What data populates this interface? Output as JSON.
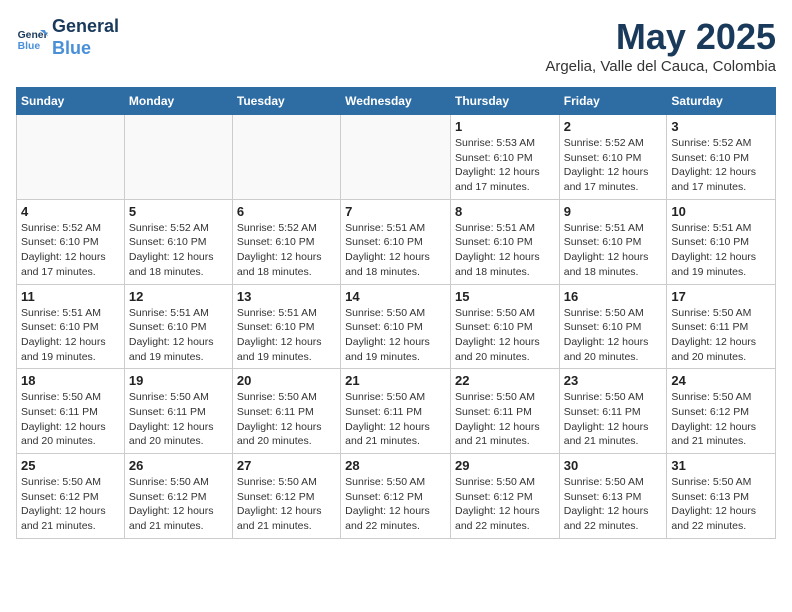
{
  "header": {
    "logo_line1": "General",
    "logo_line2": "Blue",
    "month": "May 2025",
    "location": "Argelia, Valle del Cauca, Colombia"
  },
  "weekdays": [
    "Sunday",
    "Monday",
    "Tuesday",
    "Wednesday",
    "Thursday",
    "Friday",
    "Saturday"
  ],
  "weeks": [
    [
      {
        "day": "",
        "info": ""
      },
      {
        "day": "",
        "info": ""
      },
      {
        "day": "",
        "info": ""
      },
      {
        "day": "",
        "info": ""
      },
      {
        "day": "1",
        "info": "Sunrise: 5:53 AM\nSunset: 6:10 PM\nDaylight: 12 hours\nand 17 minutes."
      },
      {
        "day": "2",
        "info": "Sunrise: 5:52 AM\nSunset: 6:10 PM\nDaylight: 12 hours\nand 17 minutes."
      },
      {
        "day": "3",
        "info": "Sunrise: 5:52 AM\nSunset: 6:10 PM\nDaylight: 12 hours\nand 17 minutes."
      }
    ],
    [
      {
        "day": "4",
        "info": "Sunrise: 5:52 AM\nSunset: 6:10 PM\nDaylight: 12 hours\nand 17 minutes."
      },
      {
        "day": "5",
        "info": "Sunrise: 5:52 AM\nSunset: 6:10 PM\nDaylight: 12 hours\nand 18 minutes."
      },
      {
        "day": "6",
        "info": "Sunrise: 5:52 AM\nSunset: 6:10 PM\nDaylight: 12 hours\nand 18 minutes."
      },
      {
        "day": "7",
        "info": "Sunrise: 5:51 AM\nSunset: 6:10 PM\nDaylight: 12 hours\nand 18 minutes."
      },
      {
        "day": "8",
        "info": "Sunrise: 5:51 AM\nSunset: 6:10 PM\nDaylight: 12 hours\nand 18 minutes."
      },
      {
        "day": "9",
        "info": "Sunrise: 5:51 AM\nSunset: 6:10 PM\nDaylight: 12 hours\nand 18 minutes."
      },
      {
        "day": "10",
        "info": "Sunrise: 5:51 AM\nSunset: 6:10 PM\nDaylight: 12 hours\nand 19 minutes."
      }
    ],
    [
      {
        "day": "11",
        "info": "Sunrise: 5:51 AM\nSunset: 6:10 PM\nDaylight: 12 hours\nand 19 minutes."
      },
      {
        "day": "12",
        "info": "Sunrise: 5:51 AM\nSunset: 6:10 PM\nDaylight: 12 hours\nand 19 minutes."
      },
      {
        "day": "13",
        "info": "Sunrise: 5:51 AM\nSunset: 6:10 PM\nDaylight: 12 hours\nand 19 minutes."
      },
      {
        "day": "14",
        "info": "Sunrise: 5:50 AM\nSunset: 6:10 PM\nDaylight: 12 hours\nand 19 minutes."
      },
      {
        "day": "15",
        "info": "Sunrise: 5:50 AM\nSunset: 6:10 PM\nDaylight: 12 hours\nand 20 minutes."
      },
      {
        "day": "16",
        "info": "Sunrise: 5:50 AM\nSunset: 6:10 PM\nDaylight: 12 hours\nand 20 minutes."
      },
      {
        "day": "17",
        "info": "Sunrise: 5:50 AM\nSunset: 6:11 PM\nDaylight: 12 hours\nand 20 minutes."
      }
    ],
    [
      {
        "day": "18",
        "info": "Sunrise: 5:50 AM\nSunset: 6:11 PM\nDaylight: 12 hours\nand 20 minutes."
      },
      {
        "day": "19",
        "info": "Sunrise: 5:50 AM\nSunset: 6:11 PM\nDaylight: 12 hours\nand 20 minutes."
      },
      {
        "day": "20",
        "info": "Sunrise: 5:50 AM\nSunset: 6:11 PM\nDaylight: 12 hours\nand 20 minutes."
      },
      {
        "day": "21",
        "info": "Sunrise: 5:50 AM\nSunset: 6:11 PM\nDaylight: 12 hours\nand 21 minutes."
      },
      {
        "day": "22",
        "info": "Sunrise: 5:50 AM\nSunset: 6:11 PM\nDaylight: 12 hours\nand 21 minutes."
      },
      {
        "day": "23",
        "info": "Sunrise: 5:50 AM\nSunset: 6:11 PM\nDaylight: 12 hours\nand 21 minutes."
      },
      {
        "day": "24",
        "info": "Sunrise: 5:50 AM\nSunset: 6:12 PM\nDaylight: 12 hours\nand 21 minutes."
      }
    ],
    [
      {
        "day": "25",
        "info": "Sunrise: 5:50 AM\nSunset: 6:12 PM\nDaylight: 12 hours\nand 21 minutes."
      },
      {
        "day": "26",
        "info": "Sunrise: 5:50 AM\nSunset: 6:12 PM\nDaylight: 12 hours\nand 21 minutes."
      },
      {
        "day": "27",
        "info": "Sunrise: 5:50 AM\nSunset: 6:12 PM\nDaylight: 12 hours\nand 21 minutes."
      },
      {
        "day": "28",
        "info": "Sunrise: 5:50 AM\nSunset: 6:12 PM\nDaylight: 12 hours\nand 22 minutes."
      },
      {
        "day": "29",
        "info": "Sunrise: 5:50 AM\nSunset: 6:12 PM\nDaylight: 12 hours\nand 22 minutes."
      },
      {
        "day": "30",
        "info": "Sunrise: 5:50 AM\nSunset: 6:13 PM\nDaylight: 12 hours\nand 22 minutes."
      },
      {
        "day": "31",
        "info": "Sunrise: 5:50 AM\nSunset: 6:13 PM\nDaylight: 12 hours\nand 22 minutes."
      }
    ]
  ]
}
